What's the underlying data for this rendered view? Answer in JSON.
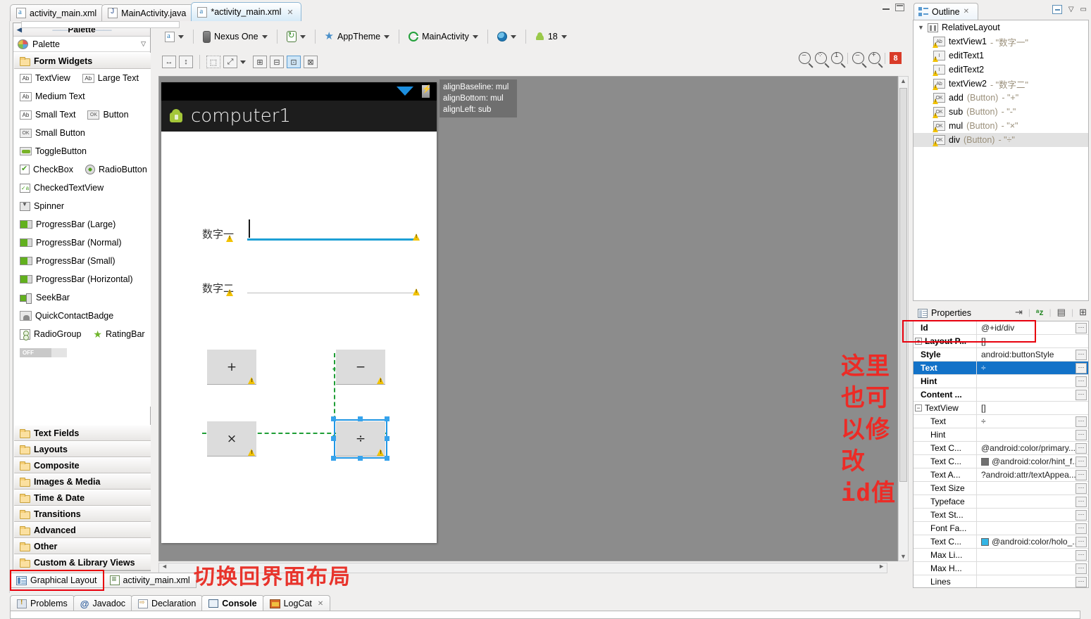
{
  "tabs": [
    {
      "label": "activity_main.xml",
      "icon": "xml-file-icon",
      "active": false,
      "dirty": false
    },
    {
      "label": "MainActivity.java",
      "icon": "java-file-icon",
      "active": false,
      "dirty": false
    },
    {
      "label": "*activity_main.xml",
      "icon": "xml-file-icon",
      "active": true,
      "dirty": true,
      "close": "✕"
    }
  ],
  "palette": {
    "title": "Palette",
    "header_label": "Palette",
    "groups_top": [
      {
        "label": "Form Widgets"
      }
    ],
    "items": [
      [
        {
          "label": "TextView",
          "icon": "ab-icon"
        },
        {
          "label": "Large Text",
          "icon": "ab-icon"
        }
      ],
      [
        {
          "label": "Medium Text",
          "icon": "ab-icon"
        }
      ],
      [
        {
          "label": "Small Text",
          "icon": "ab-icon"
        },
        {
          "label": "Button",
          "icon": "ok-icon"
        }
      ],
      [
        {
          "label": "Small Button",
          "icon": "ok-icon"
        }
      ],
      [
        {
          "label": "ToggleButton",
          "icon": "toggle-icon"
        }
      ],
      [
        {
          "label": "CheckBox",
          "icon": "checkbox-icon"
        },
        {
          "label": "RadioButton",
          "icon": "radio-icon"
        }
      ],
      [
        {
          "label": "CheckedTextView",
          "icon": "checked-textview-icon"
        }
      ],
      [
        {
          "label": "Spinner",
          "icon": "spinner-icon"
        }
      ],
      [
        {
          "label": "ProgressBar (Large)",
          "icon": "progressbar-icon"
        }
      ],
      [
        {
          "label": "ProgressBar (Normal)",
          "icon": "progressbar-icon"
        }
      ],
      [
        {
          "label": "ProgressBar (Small)",
          "icon": "progressbar-icon"
        }
      ],
      [
        {
          "label": "ProgressBar (Horizontal)",
          "icon": "progressbar-icon"
        }
      ],
      [
        {
          "label": "SeekBar",
          "icon": "seekbar-icon"
        }
      ],
      [
        {
          "label": "QuickContactBadge",
          "icon": "quickcontactbadge-icon"
        }
      ],
      [
        {
          "label": "RadioGroup",
          "icon": "radiogroup-icon"
        },
        {
          "label": "RatingBar",
          "icon": "star-icon"
        }
      ],
      [
        {
          "label": "OFF",
          "icon": "switch-icon"
        }
      ]
    ],
    "groups_bottom": [
      {
        "label": "Text Fields"
      },
      {
        "label": "Layouts"
      },
      {
        "label": "Composite"
      },
      {
        "label": "Images & Media"
      },
      {
        "label": "Time & Date"
      },
      {
        "label": "Transitions"
      },
      {
        "label": "Advanced"
      },
      {
        "label": "Other"
      },
      {
        "label": "Custom & Library Views"
      }
    ]
  },
  "editor": {
    "toolbar_top": [
      {
        "label": "",
        "icon": "config-xml-icon",
        "dropdown": true
      },
      {
        "label": "Nexus One",
        "icon": "device-icon",
        "dropdown": true
      },
      {
        "label": "",
        "icon": "orientation-icon",
        "dropdown": true
      },
      {
        "label": "AppTheme",
        "icon": "theme-star-icon",
        "dropdown": true
      },
      {
        "label": "MainActivity",
        "icon": "activity-icon",
        "dropdown": true
      },
      {
        "label": "",
        "icon": "locale-globe-icon",
        "dropdown": true
      },
      {
        "label": "18",
        "icon": "android-api-icon",
        "dropdown": true
      }
    ],
    "toolbar_bottom_icons": [
      "match-width-icon",
      "match-height-icon",
      "wrap-selection-icon",
      "expand-selection-icon",
      "expand-dropdown-icon",
      "baseline-align-icon",
      "distribute-icon",
      "align-structure-icon",
      "change-layout-icon"
    ],
    "zoom_tools": [
      "zoom-out-fit-icon",
      "zoom-fit-icon",
      "zoom-100-icon",
      "zoom-minus-icon",
      "zoom-plus-icon"
    ],
    "error_badge": "8",
    "tooltip_lines": [
      "alignBaseline: mul",
      "alignBottom: mul",
      "alignLeft: sub"
    ],
    "bottom_tabs": [
      {
        "label": "Graphical Layout",
        "icon": "graphical-layout-icon",
        "active": true
      },
      {
        "label": "activity_main.xml",
        "icon": "xml-source-icon",
        "active": false
      }
    ]
  },
  "device_preview": {
    "app_title": "computer1",
    "fields": [
      {
        "label": "数字一",
        "focused": true
      },
      {
        "label": "数字二",
        "focused": false
      }
    ],
    "buttons": [
      {
        "label": "+",
        "id": "add",
        "selected": false
      },
      {
        "label": "−",
        "id": "sub",
        "selected": false
      },
      {
        "label": "×",
        "id": "mul",
        "selected": false
      },
      {
        "label": "÷",
        "id": "div",
        "selected": true
      }
    ]
  },
  "outline": {
    "tab_label": "Outline",
    "tab_close": "✕",
    "root": {
      "label": "RelativeLayout",
      "icon": "relativelayout-icon"
    },
    "nodes": [
      {
        "name": "textView1",
        "type": "",
        "value": "- \"数字一\"",
        "icon": "textview-warn-icon",
        "selected": false
      },
      {
        "name": "editText1",
        "type": "",
        "value": "",
        "icon": "edittext-warn-icon",
        "selected": false
      },
      {
        "name": "editText2",
        "type": "",
        "value": "",
        "icon": "edittext-warn-icon",
        "selected": false
      },
      {
        "name": "textView2",
        "type": "",
        "value": "- \"数字二\"",
        "icon": "textview-warn-icon",
        "selected": false
      },
      {
        "name": "add",
        "type": "(Button)",
        "value": "- \"+\"",
        "icon": "button-warn-icon",
        "selected": false
      },
      {
        "name": "sub",
        "type": "(Button)",
        "value": "- \"-\"",
        "icon": "button-warn-icon",
        "selected": false
      },
      {
        "name": "mul",
        "type": "(Button)",
        "value": "- \"×\"",
        "icon": "button-warn-icon",
        "selected": false
      },
      {
        "name": "div",
        "type": "(Button)",
        "value": "- \"÷\"",
        "icon": "button-warn-icon",
        "selected": true
      }
    ]
  },
  "properties": {
    "tab_label": "Properties",
    "tools": [
      "show-advanced-icon",
      "sort-alpha-icon",
      "default-values-icon",
      "add-view-icon"
    ],
    "rows": [
      {
        "key": "Id",
        "value": "@+id/div",
        "bold": true,
        "more": true,
        "level": 0,
        "highlight_box": true
      },
      {
        "key": "Layout P...",
        "value": "[]",
        "bold": true,
        "more": false,
        "level": 0,
        "expander": "+"
      },
      {
        "key": "Style",
        "value": "android:buttonStyle",
        "bold": true,
        "more": true,
        "level": 0
      },
      {
        "key": "Text",
        "value": "÷",
        "bold": true,
        "more": true,
        "level": 0,
        "selected": true
      },
      {
        "key": "Hint",
        "value": "",
        "bold": true,
        "more": true,
        "level": 0
      },
      {
        "key": "Content ...",
        "value": "",
        "bold": true,
        "more": true,
        "level": 0
      },
      {
        "key": "TextView",
        "value": "[]",
        "bold": false,
        "more": false,
        "level": 0,
        "expander": "−"
      },
      {
        "key": "Text",
        "value": "÷",
        "bold": false,
        "more": true,
        "level": 1
      },
      {
        "key": "Hint",
        "value": "",
        "bold": false,
        "more": true,
        "level": 1
      },
      {
        "key": "Text C...",
        "value": "@android:color/primary...",
        "bold": false,
        "more": true,
        "level": 1
      },
      {
        "key": "Text C...",
        "value": "@android:color/hint_f...",
        "bold": false,
        "more": true,
        "level": 1,
        "swatch": "#6f6f6f"
      },
      {
        "key": "Text A...",
        "value": "?android:attr/textAppea...",
        "bold": false,
        "more": true,
        "level": 1
      },
      {
        "key": "Text Size",
        "value": "",
        "bold": false,
        "more": true,
        "level": 1
      },
      {
        "key": "Typeface",
        "value": "",
        "bold": false,
        "more": true,
        "level": 1
      },
      {
        "key": "Text St...",
        "value": "",
        "bold": false,
        "more": true,
        "level": 1
      },
      {
        "key": "Font Fa...",
        "value": "",
        "bold": false,
        "more": true,
        "level": 1
      },
      {
        "key": "Text C...",
        "value": "@android:color/holo_...",
        "bold": false,
        "more": true,
        "level": 1,
        "swatch": "#33b5e5"
      },
      {
        "key": "Max Li...",
        "value": "",
        "bold": false,
        "more": true,
        "level": 1
      },
      {
        "key": "Max H...",
        "value": "",
        "bold": false,
        "more": true,
        "level": 1
      },
      {
        "key": "Lines",
        "value": "",
        "bold": false,
        "more": true,
        "level": 1
      }
    ]
  },
  "annotations": {
    "id_note_line1": "这里也可以修改",
    "id_note_line2_bold": "id",
    "id_note_line2_rest": "值",
    "switch_note": "切换回界面布局",
    "color": "#ec2b26"
  },
  "bottom_views": [
    {
      "label": "Problems",
      "icon": "problems-icon",
      "active": false
    },
    {
      "label": "Javadoc",
      "icon": "javadoc-icon",
      "active": false
    },
    {
      "label": "Declaration",
      "icon": "declaration-icon",
      "active": false
    },
    {
      "label": "Console",
      "icon": "console-icon",
      "active": true
    },
    {
      "label": "LogCat",
      "icon": "logcat-icon",
      "active": false,
      "close": "✕"
    }
  ]
}
